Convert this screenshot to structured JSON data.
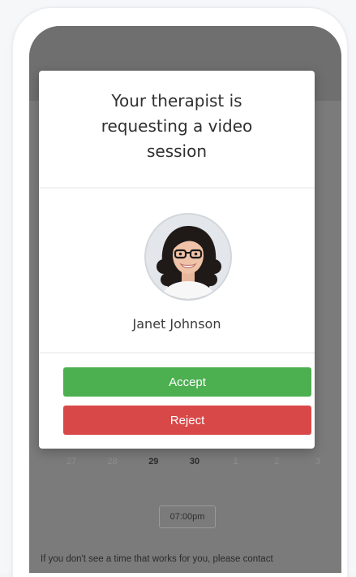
{
  "modal": {
    "title_line1": "Your therapist is",
    "title_line2": "requesting a video",
    "title_line3": "session",
    "therapist_name": "Janet Johnson",
    "accept_label": "Accept",
    "reject_label": "Reject",
    "avatar_icon": "therapist-portrait"
  },
  "background": {
    "calendar_days": [
      {
        "label": "27",
        "style": "dim"
      },
      {
        "label": "28",
        "style": "dim"
      },
      {
        "label": "29",
        "style": "strong"
      },
      {
        "label": "30",
        "style": "strong"
      },
      {
        "label": "1",
        "style": "dim"
      },
      {
        "label": "2",
        "style": "dim"
      },
      {
        "label": "3",
        "style": "dim"
      }
    ],
    "time_slot": "07:00pm",
    "notice": "If you don't see a time that works for you, please contact"
  },
  "colors": {
    "accept": "#4caf50",
    "reject": "#d94848",
    "overlay": "#7b7b7b"
  }
}
